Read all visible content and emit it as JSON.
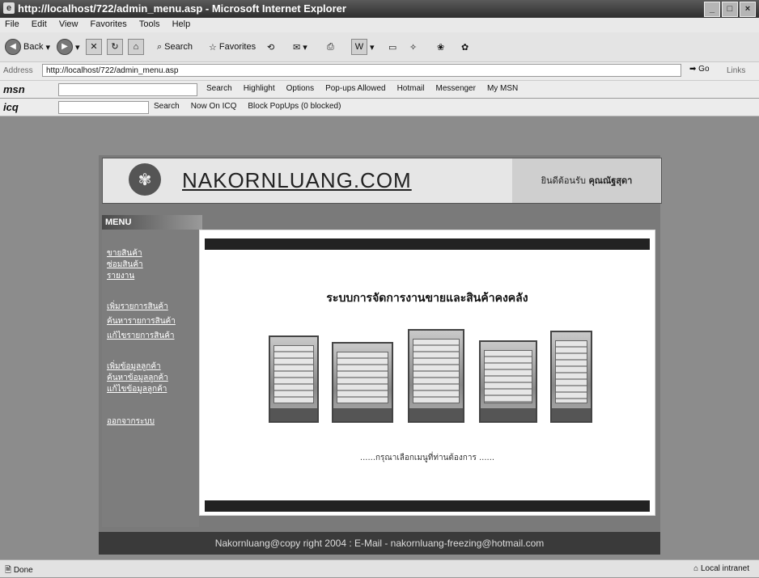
{
  "window": {
    "title": "http://localhost/722/admin_menu.asp - Microsoft Internet Explorer"
  },
  "menu": [
    "File",
    "Edit",
    "View",
    "Favorites",
    "Tools",
    "Help"
  ],
  "toolbar": {
    "back": "Back",
    "search": "Search",
    "favorites": "Favorites"
  },
  "address": {
    "label": "Address",
    "url": "http://localhost/722/admin_menu.asp",
    "go": "Go",
    "links": "Links"
  },
  "msn": {
    "logo": "msn",
    "items": [
      "Search",
      "Highlight",
      "Options",
      "Pop-ups Allowed",
      "Hotmail",
      "Messenger",
      "My MSN"
    ]
  },
  "icq": {
    "logo": "icq",
    "items": [
      "Search",
      "Now On ICQ",
      "Block PopUps (0 blocked)"
    ]
  },
  "banner": {
    "brand": "NAKORNLUANG.COM",
    "greeting": "ยินดีต้อนรับ",
    "user": "คุณณัฐสุดา"
  },
  "sidebar": {
    "heading": "MENU",
    "items": [
      "ขายสินค้า",
      "ซ่อมสินค้า",
      "รายงาน",
      "เพิ่มรายการสินค้า",
      "ค้นหารายการสินค้า",
      "แก้ไขรายการสินค้า",
      "เพิ่มข้อมูลลูกค้า",
      "ค้นหาข้อมูลลูกค้า",
      "แก้ไขข้อมูลลูกค้า",
      "ออกจากระบบ"
    ]
  },
  "main": {
    "heading": "ระบบการจัดการงานขายและสินค้าคงคลัง",
    "prompt": "......กรุณาเลือกเมนูที่ท่านต้องการ ......"
  },
  "footer": {
    "text": "Nakornluang@copy right 2004 : E-Mail - nakornluang-freezing@hotmail.com"
  },
  "status": {
    "left": "Done",
    "zone": "Local intranet"
  }
}
